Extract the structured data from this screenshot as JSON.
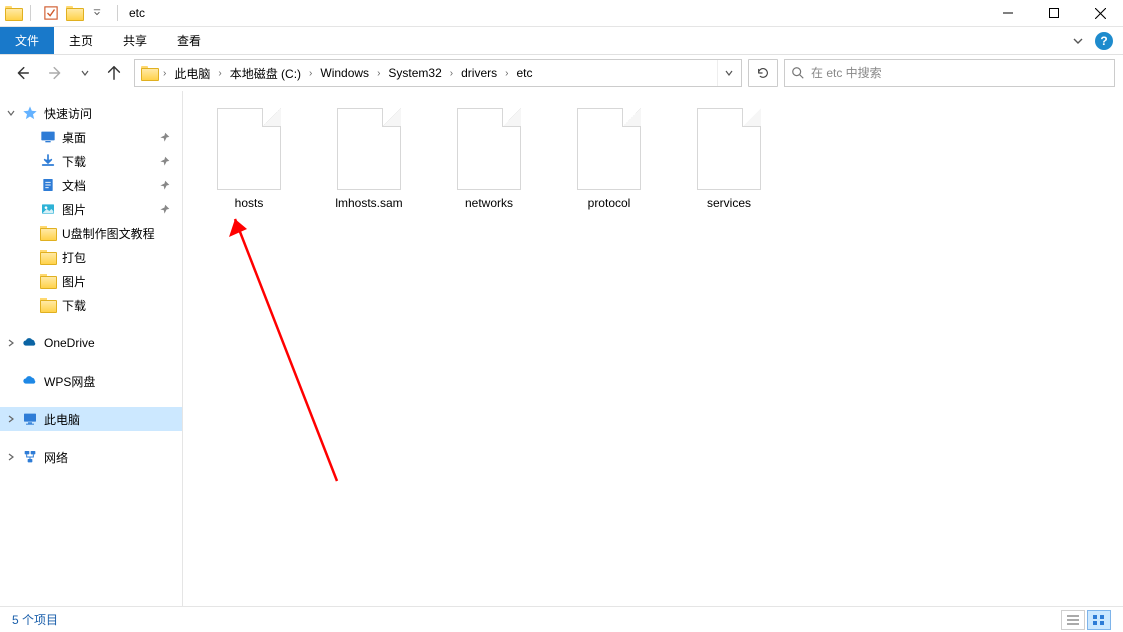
{
  "window": {
    "title": "etc"
  },
  "ribbon": {
    "file": "文件",
    "tabs": [
      "主页",
      "共享",
      "查看"
    ]
  },
  "breadcrumb": [
    "此电脑",
    "本地磁盘 (C:)",
    "Windows",
    "System32",
    "drivers",
    "etc"
  ],
  "search": {
    "placeholder": "在 etc 中搜索"
  },
  "sidebar": {
    "quick_access": "快速访问",
    "items": [
      {
        "label": "桌面",
        "icon": "desktop",
        "pinned": true
      },
      {
        "label": "下载",
        "icon": "download",
        "pinned": true
      },
      {
        "label": "文档",
        "icon": "docs",
        "pinned": true
      },
      {
        "label": "图片",
        "icon": "pics",
        "pinned": true
      },
      {
        "label": "U盘制作图文教程",
        "icon": "folder",
        "pinned": false
      },
      {
        "label": "打包",
        "icon": "folder",
        "pinned": false
      },
      {
        "label": "图片",
        "icon": "folder",
        "pinned": false
      },
      {
        "label": "下载",
        "icon": "folder",
        "pinned": false
      }
    ],
    "onedrive": "OneDrive",
    "wps": "WPS网盘",
    "this_pc": "此电脑",
    "network": "网络"
  },
  "files": [
    {
      "name": "hosts"
    },
    {
      "name": "lmhosts.sam"
    },
    {
      "name": "networks"
    },
    {
      "name": "protocol"
    },
    {
      "name": "services"
    }
  ],
  "status": {
    "text": "5 个项目"
  }
}
